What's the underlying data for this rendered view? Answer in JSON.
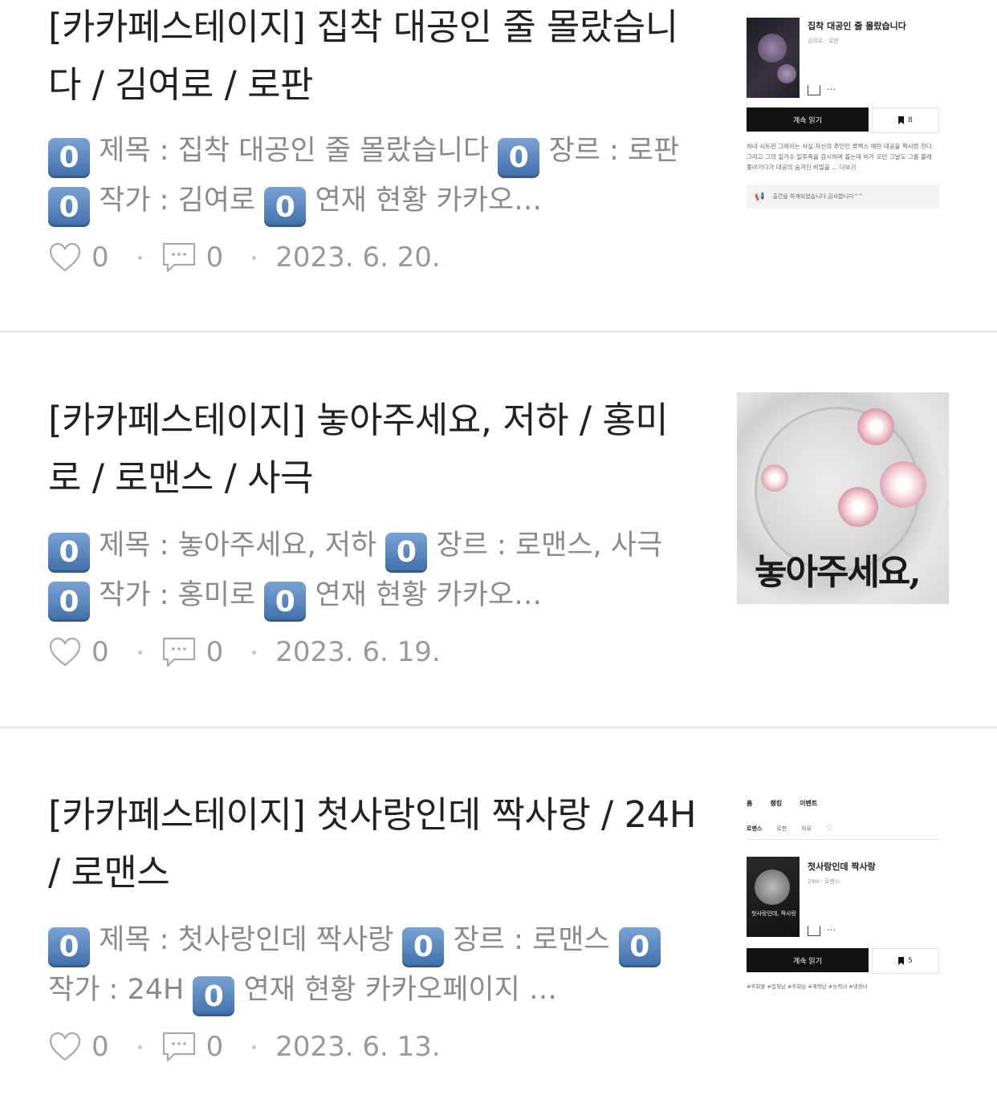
{
  "posts": [
    {
      "title": "[카카페스테이지] 집착 대공인 줄 몰랐습니다 / 김여로 / 로판",
      "badge": "0",
      "snippet_parts": [
        "제목 : 집착 대공인 줄 몰랐습니다 ",
        "장르 : 로판 ",
        "작가 : 김여로 ",
        "연재 현황 카카오…"
      ],
      "likes": "0",
      "comments": "0",
      "date": "2023. 6. 20.",
      "thumb": {
        "type": "app",
        "book_title": "집착 대공인 줄 몰랐습니다",
        "book_meta": "김여로 · 로판",
        "share_more": "…",
        "read_button": "계속 읽기",
        "bookmark_count": "8",
        "description": "하녀 시트린 그레이는 사실 자신의 주인인 류백스 예란 대공을 짝사랑 한다. 그리고 그의 일거수 일투족을 감시하며 몰는데 비가 오던 그날도 그를 몰래 쫓아가다가 대공의 숨겨진 비밀을 ... 더보기",
        "notice": "출간을 하게되었습니다.감사합니다^^"
      }
    },
    {
      "title": "[카카페스테이지] 놓아주세요, 저하 / 홍미로 / 로맨스 / 사극",
      "badge": "0",
      "snippet_parts": [
        "제목 : 놓아주세요, 저하 ",
        "장르 : 로맨스, 사극 ",
        "작가 : 홍미로 ",
        "연재 현황 카카오…"
      ],
      "likes": "0",
      "comments": "0",
      "date": "2023. 6. 19.",
      "thumb": {
        "type": "cover",
        "cover_text": "놓아주세요,"
      }
    },
    {
      "title": "[카카페스테이지] 첫사랑인데 짝사랑 / 24H / 로맨스",
      "badge": "0",
      "snippet_parts": [
        "제목 : 첫사랑인데 짝사랑 ",
        "장르 : 로맨스 ",
        "작가 : 24H ",
        "연재 현황 카카오페이지 …"
      ],
      "likes": "0",
      "comments": "0",
      "date": "2023. 6. 13.",
      "thumb": {
        "type": "app",
        "nav": [
          "홈",
          "랭킹",
          "이벤트"
        ],
        "tabs": [
          "로맨스",
          "로판",
          "자유"
        ],
        "book_title": "첫사랑인데 짝사랑",
        "book_meta": "24H · 로맨스",
        "cover_text": "첫사랑인데, 짝사랑",
        "share_more": "…",
        "read_button": "계속 읽기",
        "bookmark_count": "5",
        "tags": "#후회물 #집착남 #후회남 #계략남 #능력녀 #냉정녀"
      }
    }
  ],
  "colors": {
    "badge_top": "#7aa3d4",
    "badge_bottom": "#3f6ea8",
    "meta": "#9a9a9a",
    "snippet": "#8a8a8a"
  }
}
